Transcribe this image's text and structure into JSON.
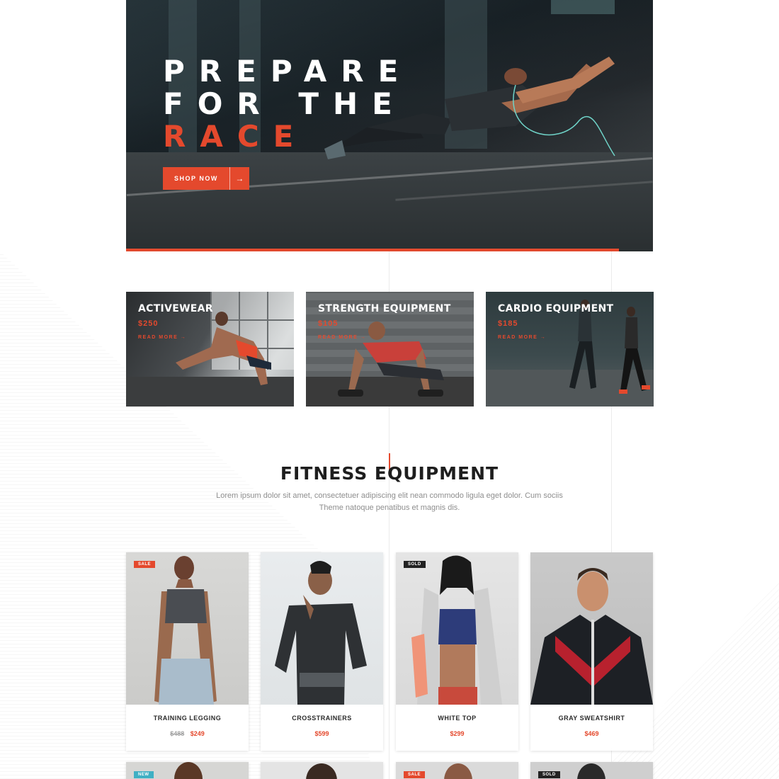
{
  "hero": {
    "title_line1": "PREPARE",
    "title_line2": "FOR THE",
    "title_line3": "RACE",
    "button_label": "SHOP NOW",
    "button_arrow": "→"
  },
  "categories": [
    {
      "title": "ACTIVEWEAR",
      "price": "$250",
      "link": "READ MORE →"
    },
    {
      "title": "STRENGTH EQUIPMENT",
      "price": "$105",
      "link": "READ MORE →"
    },
    {
      "title": "CARDIO EQUIPMENT",
      "price": "$185",
      "link": "READ MORE →"
    }
  ],
  "section": {
    "title": "FITNESS EQUIPMENT",
    "description": "Lorem ipsum dolor sit amet, consectetuer adipiscing elit nean commodo ligula eget dolor. Cum sociis Theme natoque penatibus et magnis dis."
  },
  "products": [
    {
      "name": "TRAINING LEGGING",
      "old_price": "$488",
      "price": "$249",
      "badge": "SALE"
    },
    {
      "name": "CROSSTRAINERS",
      "old_price": "",
      "price": "$599",
      "badge": ""
    },
    {
      "name": "WHITE TOP",
      "old_price": "",
      "price": "$299",
      "badge": "SOLD"
    },
    {
      "name": "GRAY SWEATSHIRT",
      "old_price": "",
      "price": "$469",
      "badge": ""
    }
  ],
  "products_row2_badges": [
    "NEW",
    "",
    "SALE",
    "SOLD"
  ],
  "colors": {
    "accent": "#e4492d",
    "badge_new": "#3fb0c4",
    "badge_sold": "#222222"
  }
}
